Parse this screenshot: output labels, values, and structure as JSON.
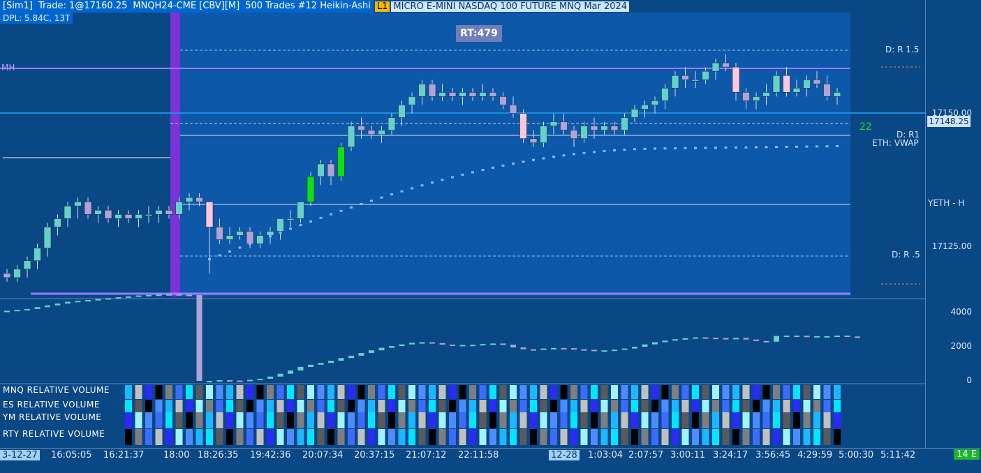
{
  "header": {
    "account": "[Sim1]",
    "trade": "Trade: 1@17160.25",
    "instrument": "MNQH24-CME [CBV][M]",
    "bar_type": "500 Trades #12 Heikin-Ashi",
    "level_badge": "L1",
    "description": "MICRO E-MINI NASDAQ 100 FUTURE MNQ Mar 2024"
  },
  "dpl": "DPL: 5.84C, 13T",
  "rt_badge": "RT:479",
  "level_labels": {
    "mh": "MH",
    "r15": "D: R 1.5",
    "r1": "D: R1",
    "vwap": "ETH: VWAP",
    "yeth": "YETH - H",
    "r05": "D: R .5",
    "counter": "22"
  },
  "price_axis": {
    "p1": "17150.00",
    "current": "17148.25",
    "p2": "17125.00"
  },
  "volume_axis": [
    "4000",
    "2000",
    "0"
  ],
  "indicators": [
    "MNQ RELATIVE VOLUME",
    "ES RELATIVE VOLUME",
    "YM RELATIVE VOLUME",
    "RTY RELATIVE VOLUME"
  ],
  "time_axis": [
    "3-12-27",
    "16:05:05",
    "16:21:37",
    "18:00",
    "18:26:35",
    "19:42:36",
    "20:07:34",
    "20:37:15",
    "21:07:12",
    "22:11:58",
    "12-28",
    "1:03:04",
    "2:07:57",
    "3:00:11",
    "3:24:17",
    "3:56:45",
    "4:29:59",
    "5:00:30",
    "5:11:42"
  ],
  "e_badge": "14 E",
  "colors": {
    "bull": "#66d1c8",
    "bull_strong": "#10e010",
    "bear": "#b0a3d6",
    "bear_strong": "#ffc7dc",
    "vwap": "#8fb8f0",
    "mh_line": "#9b7bff",
    "session_bar": "#7b32d6"
  },
  "chart_data": {
    "type": "candlestick",
    "price_range": [
      17109,
      17167
    ],
    "ohlc": [
      [
        17114,
        17115,
        17112,
        17113
      ],
      [
        17113,
        17116,
        17112,
        17115
      ],
      [
        17115,
        17118,
        17113,
        17117
      ],
      [
        17117,
        17121,
        17115,
        17120
      ],
      [
        17120,
        17126,
        17118,
        17125
      ],
      [
        17125,
        17128,
        17123,
        17127
      ],
      [
        17127,
        17131,
        17125,
        17130
      ],
      [
        17130,
        17132,
        17127,
        17131
      ],
      [
        17131,
        17132,
        17127,
        17128
      ],
      [
        17128,
        17130,
        17126,
        17129
      ],
      [
        17129,
        17130,
        17126,
        17127
      ],
      [
        17127,
        17129,
        17125,
        17128
      ],
      [
        17128,
        17129,
        17126,
        17127
      ],
      [
        17127,
        17129,
        17125,
        17128
      ],
      [
        17128,
        17130,
        17126,
        17128
      ],
      [
        17128,
        17130,
        17126,
        17129
      ],
      [
        17129,
        17130,
        17127,
        17128
      ],
      [
        17128,
        17132,
        17127,
        17131
      ],
      [
        17131,
        17133,
        17129,
        17132
      ],
      [
        17132,
        17133,
        17130,
        17131
      ],
      [
        17131,
        17131,
        17114,
        17125
      ],
      [
        17125,
        17127,
        17121,
        17122
      ],
      [
        17122,
        17125,
        17121,
        17123
      ],
      [
        17123,
        17125,
        17122,
        17124
      ],
      [
        17124,
        17125,
        17120,
        17121
      ],
      [
        17121,
        17124,
        17120,
        17123
      ],
      [
        17123,
        17125,
        17121,
        17124
      ],
      [
        17124,
        17127,
        17122,
        17127
      ],
      [
        17127,
        17129,
        17125,
        17127
      ],
      [
        17127,
        17131,
        17126,
        17131
      ],
      [
        17131,
        17138,
        17130,
        17137
      ],
      [
        17137,
        17141,
        17135,
        17140
      ],
      [
        17140,
        17141,
        17135,
        17137
      ],
      [
        17137,
        17145,
        17136,
        17144
      ],
      [
        17144,
        17150,
        17143,
        17149
      ],
      [
        17149,
        17151,
        17146,
        17148
      ],
      [
        17148,
        17149,
        17146,
        17147
      ],
      [
        17147,
        17149,
        17145,
        17148
      ],
      [
        17148,
        17152,
        17147,
        17151
      ],
      [
        17151,
        17155,
        17149,
        17154
      ],
      [
        17154,
        17157,
        17152,
        17156
      ],
      [
        17156,
        17160,
        17154,
        17159
      ],
      [
        17159,
        17160,
        17155,
        17156
      ],
      [
        17156,
        17159,
        17155,
        17157
      ],
      [
        17157,
        17158,
        17155,
        17156
      ],
      [
        17156,
        17158,
        17154,
        17157
      ],
      [
        17157,
        17158,
        17155,
        17156
      ],
      [
        17156,
        17159,
        17155,
        17157
      ],
      [
        17157,
        17158,
        17155,
        17156
      ],
      [
        17156,
        17157,
        17153,
        17154
      ],
      [
        17154,
        17156,
        17151,
        17152
      ],
      [
        17152,
        17153,
        17145,
        17146
      ],
      [
        17146,
        17148,
        17144,
        17145
      ],
      [
        17145,
        17150,
        17144,
        17149
      ],
      [
        17149,
        17152,
        17147,
        17150
      ],
      [
        17150,
        17152,
        17147,
        17148
      ],
      [
        17148,
        17149,
        17144,
        17146
      ],
      [
        17146,
        17150,
        17145,
        17149
      ],
      [
        17149,
        17151,
        17146,
        17148
      ],
      [
        17148,
        17150,
        17147,
        17149
      ],
      [
        17149,
        17150,
        17147,
        17148
      ],
      [
        17148,
        17152,
        17147,
        17151
      ],
      [
        17151,
        17154,
        17150,
        17153
      ],
      [
        17153,
        17155,
        17151,
        17154
      ],
      [
        17154,
        17156,
        17152,
        17155
      ],
      [
        17155,
        17159,
        17153,
        17158
      ],
      [
        17158,
        17162,
        17156,
        17161
      ],
      [
        17161,
        17163,
        17158,
        17160
      ],
      [
        17160,
        17162,
        17158,
        17160
      ],
      [
        17160,
        17163,
        17159,
        17162
      ],
      [
        17162,
        17165,
        17160,
        17164
      ],
      [
        17164,
        17166,
        17162,
        17163
      ],
      [
        17163,
        17164,
        17155,
        17157
      ],
      [
        17157,
        17158,
        17153,
        17155
      ],
      [
        17155,
        17157,
        17153,
        17156
      ],
      [
        17156,
        17159,
        17154,
        17157
      ],
      [
        17157,
        17162,
        17156,
        17161
      ],
      [
        17161,
        17163,
        17156,
        17157
      ],
      [
        17157,
        17160,
        17156,
        17158
      ],
      [
        17158,
        17161,
        17156,
        17160
      ],
      [
        17160,
        17162,
        17158,
        17159
      ],
      [
        17159,
        17161,
        17155,
        17156
      ],
      [
        17156,
        17158,
        17154,
        17157
      ]
    ],
    "volume_scale": [
      0,
      4500
    ],
    "volume_values": [
      3900,
      3950,
      4000,
      4100,
      4200,
      4300,
      4400,
      4450,
      4500,
      4550,
      4600,
      4650,
      4700,
      4750,
      4780,
      4800,
      4820,
      4790,
      4770,
      0,
      0,
      40,
      20,
      10,
      60,
      120,
      240,
      400,
      580,
      780,
      900,
      1000,
      1120,
      1270,
      1400,
      1550,
      1700,
      1840,
      1940,
      2030,
      2120,
      2150,
      2100,
      2020,
      1980,
      2000,
      2010,
      2050,
      2080,
      2010,
      1860,
      1760,
      1750,
      1800,
      1830,
      1820,
      1760,
      1730,
      1690,
      1700,
      1740,
      1800,
      1900,
      2030,
      2150,
      2240,
      2320,
      2370,
      2420,
      2400,
      2380,
      2360,
      2390,
      2300,
      2220,
      2180,
      2500,
      2520,
      2510,
      2470,
      2490,
      2490,
      2520,
      2470,
      2450
    ]
  }
}
